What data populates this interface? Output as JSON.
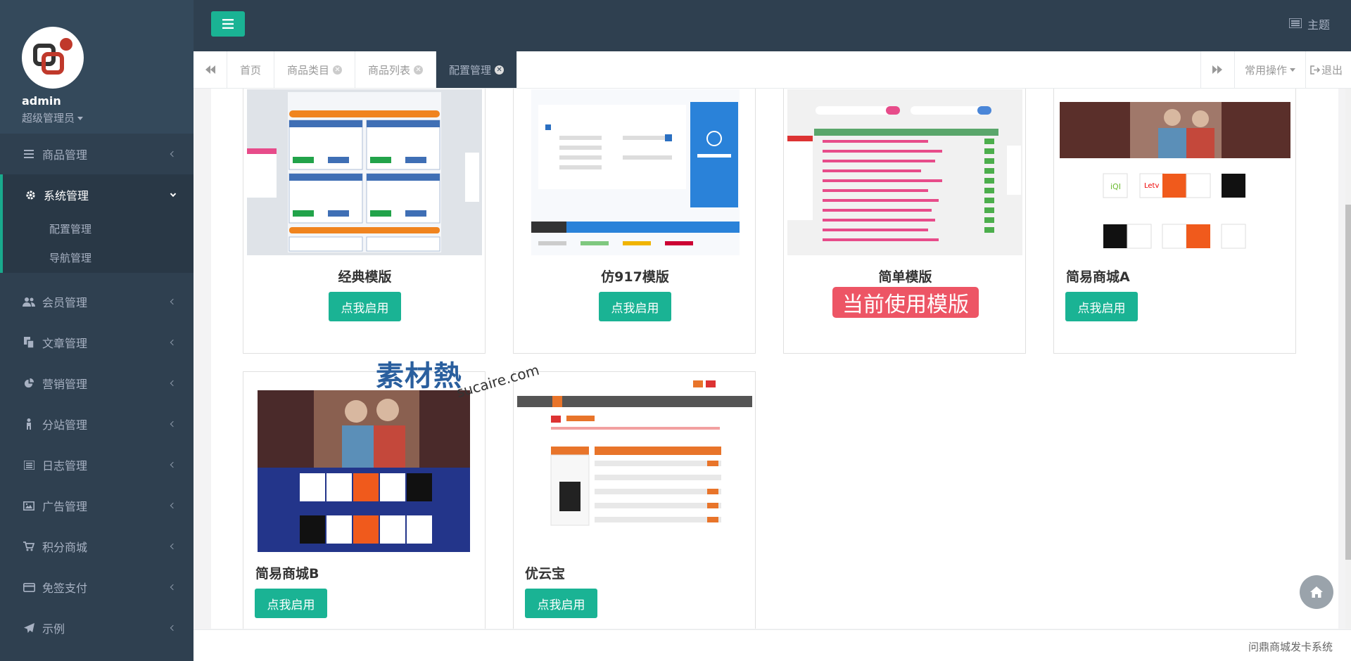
{
  "user": {
    "name": "admin",
    "role": "超级管理员"
  },
  "sidebar": {
    "items": [
      {
        "label": "商品管理",
        "icon": "bars-icon"
      },
      {
        "label": "系统管理",
        "icon": "gear-icon",
        "active": true,
        "children": [
          {
            "label": "配置管理"
          },
          {
            "label": "导航管理"
          }
        ]
      },
      {
        "label": "会员管理",
        "icon": "users-icon"
      },
      {
        "label": "文章管理",
        "icon": "files-icon"
      },
      {
        "label": "营销管理",
        "icon": "pie-chart-icon"
      },
      {
        "label": "分站管理",
        "icon": "child-icon"
      },
      {
        "label": "日志管理",
        "icon": "list-icon"
      },
      {
        "label": "广告管理",
        "icon": "image-icon"
      },
      {
        "label": "积分商城",
        "icon": "cart-icon"
      },
      {
        "label": "免签支付",
        "icon": "credit-card-icon"
      },
      {
        "label": "示例",
        "icon": "paper-plane-icon"
      }
    ]
  },
  "header": {
    "theme_label": "主题"
  },
  "tabs": {
    "items": [
      {
        "label": "首页",
        "closable": false
      },
      {
        "label": "商品类目",
        "closable": true
      },
      {
        "label": "商品列表",
        "closable": true
      },
      {
        "label": "配置管理",
        "closable": true,
        "active": true
      }
    ],
    "common_ops": "常用操作",
    "logout": "退出"
  },
  "templates": [
    {
      "name": "经典模版",
      "button": "点我启用"
    },
    {
      "name": "仿917模版",
      "button": "点我启用"
    },
    {
      "name": "简单模版",
      "current_label": "当前使用模版"
    },
    {
      "name": "简易商城A",
      "button": "点我启用"
    },
    {
      "name": "简易商城B",
      "button": "点我启用"
    },
    {
      "name": "优云宝",
      "button": "点我启用"
    }
  ],
  "watermark": {
    "main": "素材熱",
    "sub": "sucaire.com"
  },
  "footer": {
    "text": "问鼎商城发卡系统"
  },
  "colors": {
    "sidebar_bg": "#2f4050",
    "accent": "#1ab394",
    "danger": "#ed5565"
  }
}
